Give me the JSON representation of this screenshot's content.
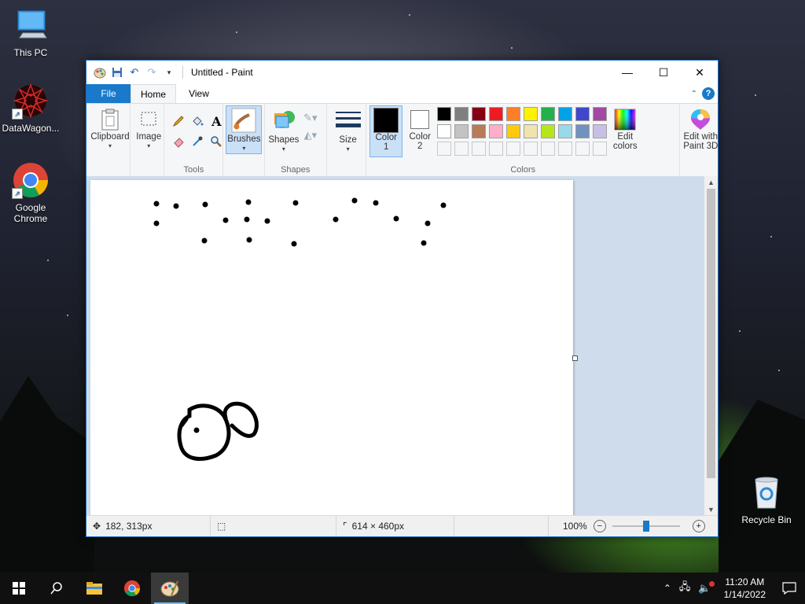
{
  "desktop": {
    "icons": [
      {
        "label": "This PC"
      },
      {
        "label": "DataWagon..."
      },
      {
        "label": "Google Chrome"
      },
      {
        "label": "Recycle Bin"
      }
    ]
  },
  "window": {
    "title": "Untitled - Paint",
    "tabs": {
      "file": "File",
      "home": "Home",
      "view": "View"
    },
    "help_label": "?"
  },
  "ribbon": {
    "clipboard": {
      "button": "Clipboard",
      "group": ""
    },
    "image": {
      "button": "Image",
      "group": ""
    },
    "tools": {
      "group": "Tools"
    },
    "brushes": {
      "button": "Brushes"
    },
    "shapes": {
      "button": "Shapes",
      "group": "Shapes"
    },
    "size": {
      "button": "Size"
    },
    "color1": {
      "label": "Color",
      "num": "1",
      "value": "#000000"
    },
    "color2": {
      "label": "Color",
      "num": "2",
      "value": "#ffffff"
    },
    "colors_group": "Colors",
    "edit_colors": {
      "line1": "Edit",
      "line2": "colors"
    },
    "edit_paint3d": {
      "line1": "Edit with",
      "line2": "Paint 3D"
    },
    "palette_row1": [
      "#000000",
      "#7f7f7f",
      "#880015",
      "#ed1c24",
      "#ff7f27",
      "#fff200",
      "#22b14c",
      "#00a2e8",
      "#3f48cc",
      "#a349a4"
    ],
    "palette_row2": [
      "#ffffff",
      "#c3c3c3",
      "#b97a57",
      "#ffaec9",
      "#ffc90e",
      "#efe4b0",
      "#b5e61d",
      "#99d9ea",
      "#7092be",
      "#c8bfe7"
    ]
  },
  "status": {
    "cursor_pos": "182, 313px",
    "selection_size": "",
    "image_size": "614 × 460px",
    "zoom": "100%"
  },
  "taskbar": {
    "time": "11:20 AM",
    "date": "1/14/2022"
  }
}
